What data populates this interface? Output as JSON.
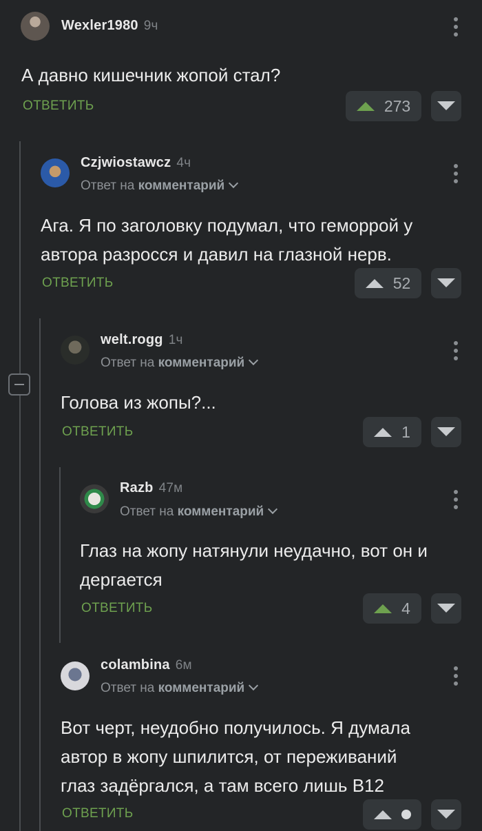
{
  "comments": [
    {
      "username": "Wexler1980",
      "time": "9ч",
      "text_lines": [
        "А давно кишечник жопой стал?"
      ],
      "reply_label": "ОТВЕТИТЬ",
      "votes": "273",
      "vote_color": "green"
    },
    {
      "username": "Czjwiostawcz",
      "time": "4ч",
      "reply_prefix": "Ответ на",
      "reply_target": "комментарий",
      "text_lines": [
        "Ага. Я по заголовку подумал, что геморрой у",
        "автора разросся и давил на глазной нерв."
      ],
      "reply_label": "ОТВЕТИТЬ",
      "votes": "52"
    },
    {
      "username": "welt.rogg",
      "time": "1ч",
      "reply_prefix": "Ответ на",
      "reply_target": "комментарий",
      "text_lines": [
        "Голова из жопы?..."
      ],
      "reply_label": "ОТВЕТИТЬ",
      "votes": "1"
    },
    {
      "username": "Razb",
      "time": "47м",
      "reply_prefix": "Ответ на",
      "reply_target": "комментарий",
      "text_lines": [
        "Глаз на жопу натянули неудачно, вот он и",
        "дергается"
      ],
      "reply_label": "ОТВЕТИТЬ",
      "votes": "4",
      "vote_color": "green"
    },
    {
      "username": "colambina",
      "time": "6м",
      "reply_prefix": "Ответ на",
      "reply_target": "комментарий",
      "text_lines": [
        "Вот черт, неудобно получилось. Я думала",
        "автор в жопу шпилится, от переживаний",
        "глаз задёргался, а там всего лишь В12"
      ],
      "reply_label": "ОТВЕТИТЬ",
      "votes": ""
    }
  ],
  "colors": {
    "background": "#232527",
    "accent_green": "#6ea14f",
    "button_bg": "#33373a"
  },
  "icons": [
    "vote-up-icon",
    "vote-down-icon",
    "more-icon",
    "chevron-down-icon",
    "collapse-icon"
  ]
}
